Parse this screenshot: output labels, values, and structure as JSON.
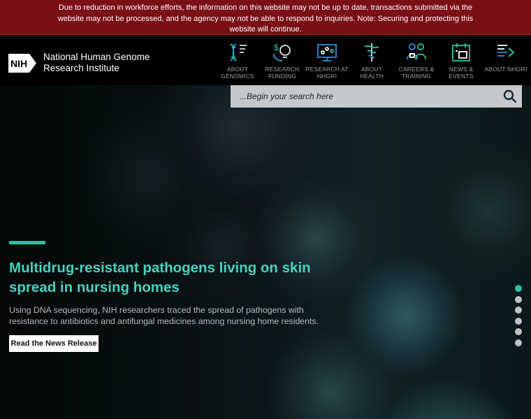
{
  "alert": {
    "text": "Due to reduction in workforce efforts, the information on this website may not be up to date, transactions submitted via the website may not be processed, and the agency may not be able to respond to inquiries. Note: Securing and protecting this website will continue."
  },
  "header": {
    "logo_text": "NIH",
    "org_name": "National Human Genome Research Institute"
  },
  "nav": [
    {
      "label": "About Genomics",
      "icon": "dna-icon"
    },
    {
      "label": "Research Funding",
      "icon": "funding-icon"
    },
    {
      "label": "Research at NHGRI",
      "icon": "research-icon"
    },
    {
      "label": "About Health",
      "icon": "health-icon"
    },
    {
      "label": "Careers & Training",
      "icon": "careers-icon"
    },
    {
      "label": "News & Events",
      "icon": "news-icon"
    },
    {
      "label": "About NHGRI",
      "icon": "about-icon"
    }
  ],
  "search": {
    "placeholder": "...Begin your search here"
  },
  "hero": {
    "headline": "Multidrug-resistant pathogens living on skin spread in nursing homes",
    "summary": "Using DNA sequencing, NIH researchers traced the spread of pathogens with resistance to antibiotics and antifungal medicines among nursing home residents.",
    "cta_label": "Read the News Release",
    "slide_count": 6,
    "active_slide": 1
  },
  "colors": {
    "alert_bg": "#7a0f15",
    "accent": "#2ac0a5",
    "nav_icon_blue": "#2a8fd6",
    "nav_icon_green": "#2ac0a5"
  }
}
